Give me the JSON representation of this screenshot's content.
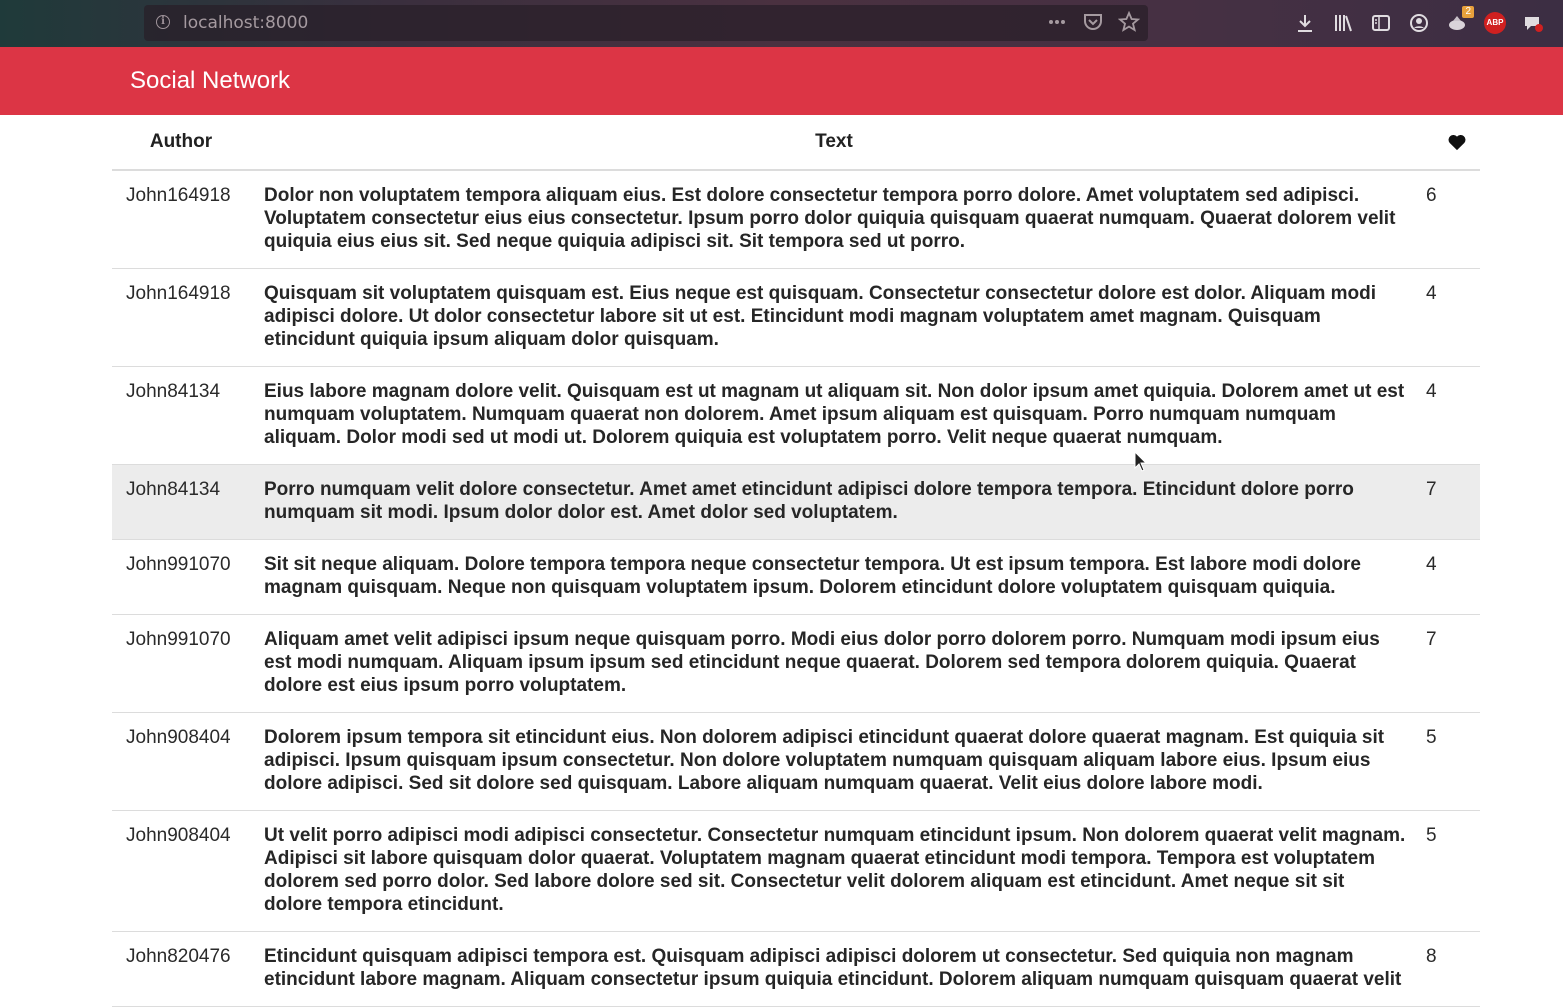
{
  "browser": {
    "url": "localhost:8000",
    "badge_count": "2",
    "abp_label": "ABP"
  },
  "app": {
    "title": "Social Network"
  },
  "table": {
    "headers": {
      "author": "Author",
      "text": "Text",
      "likes_icon": "heart-icon"
    },
    "rows": [
      {
        "author": "John164918",
        "text": "Dolor non voluptatem tempora aliquam eius. Est dolore consectetur tempora porro dolore. Amet voluptatem sed adipisci. Voluptatem consectetur eius eius consectetur. Ipsum porro dolor quiquia quisquam quaerat numquam. Quaerat dolorem velit quiquia eius eius sit. Sed neque quiquia adipisci sit. Sit tempora sed ut porro.",
        "likes": "6"
      },
      {
        "author": "John164918",
        "text": "Quisquam sit voluptatem quisquam est. Eius neque est quisquam. Consectetur consectetur dolore est dolor. Aliquam modi adipisci dolore. Ut dolor consectetur labore sit ut est. Etincidunt modi magnam voluptatem amet magnam. Quisquam etincidunt quiquia ipsum aliquam dolor quisquam.",
        "likes": "4"
      },
      {
        "author": "John84134",
        "text": "Eius labore magnam dolore velit. Quisquam est ut magnam ut aliquam sit. Non dolor ipsum amet quiquia. Dolorem amet ut est numquam voluptatem. Numquam quaerat non dolorem. Amet ipsum aliquam est quisquam. Porro numquam numquam aliquam. Dolor modi sed ut modi ut. Dolorem quiquia est voluptatem porro. Velit neque quaerat numquam.",
        "likes": "4"
      },
      {
        "author": "John84134",
        "text": "Porro numquam velit dolore consectetur. Amet amet etincidunt adipisci dolore tempora tempora. Etincidunt dolore porro numquam sit modi. Ipsum dolor dolor est. Amet dolor sed voluptatem.",
        "likes": "7"
      },
      {
        "author": "John991070",
        "text": "Sit sit neque aliquam. Dolore tempora tempora neque consectetur tempora. Ut est ipsum tempora. Est labore modi dolore magnam quisquam. Neque non quisquam voluptatem ipsum. Dolorem etincidunt dolore voluptatem quisquam quiquia.",
        "likes": "4"
      },
      {
        "author": "John991070",
        "text": "Aliquam amet velit adipisci ipsum neque quisquam porro. Modi eius dolor porro dolorem porro. Numquam modi ipsum eius est modi numquam. Aliquam ipsum ipsum sed etincidunt neque quaerat. Dolorem sed tempora dolorem quiquia. Quaerat dolore est eius ipsum porro voluptatem.",
        "likes": "7"
      },
      {
        "author": "John908404",
        "text": "Dolorem ipsum tempora sit etincidunt eius. Non dolorem adipisci etincidunt quaerat dolore quaerat magnam. Est quiquia sit adipisci. Ipsum quisquam ipsum consectetur. Non dolore voluptatem numquam quisquam aliquam labore eius. Ipsum eius dolore adipisci. Sed sit dolore sed quisquam. Labore aliquam numquam quaerat. Velit eius dolore labore modi.",
        "likes": "5"
      },
      {
        "author": "John908404",
        "text": "Ut velit porro adipisci modi adipisci consectetur. Consectetur numquam etincidunt ipsum. Non dolorem quaerat velit magnam. Adipisci sit labore quisquam dolor quaerat. Voluptatem magnam quaerat etincidunt modi tempora. Tempora est voluptatem dolorem sed porro dolor. Sed labore dolore sed sit. Consectetur velit dolorem aliquam est etincidunt. Amet neque sit sit dolore tempora etincidunt.",
        "likes": "5"
      },
      {
        "author": "John820476",
        "text": "Etincidunt quisquam adipisci tempora est. Quisquam adipisci adipisci dolorem ut consectetur. Sed quiquia non magnam etincidunt labore magnam. Aliquam consectetur ipsum quiquia etincidunt. Dolorem aliquam numquam quisquam quaerat velit",
        "likes": "8"
      }
    ],
    "hovered_row": 3
  },
  "colors": {
    "header_bg": "#dc3545",
    "hover_row_bg": "#ececec"
  }
}
